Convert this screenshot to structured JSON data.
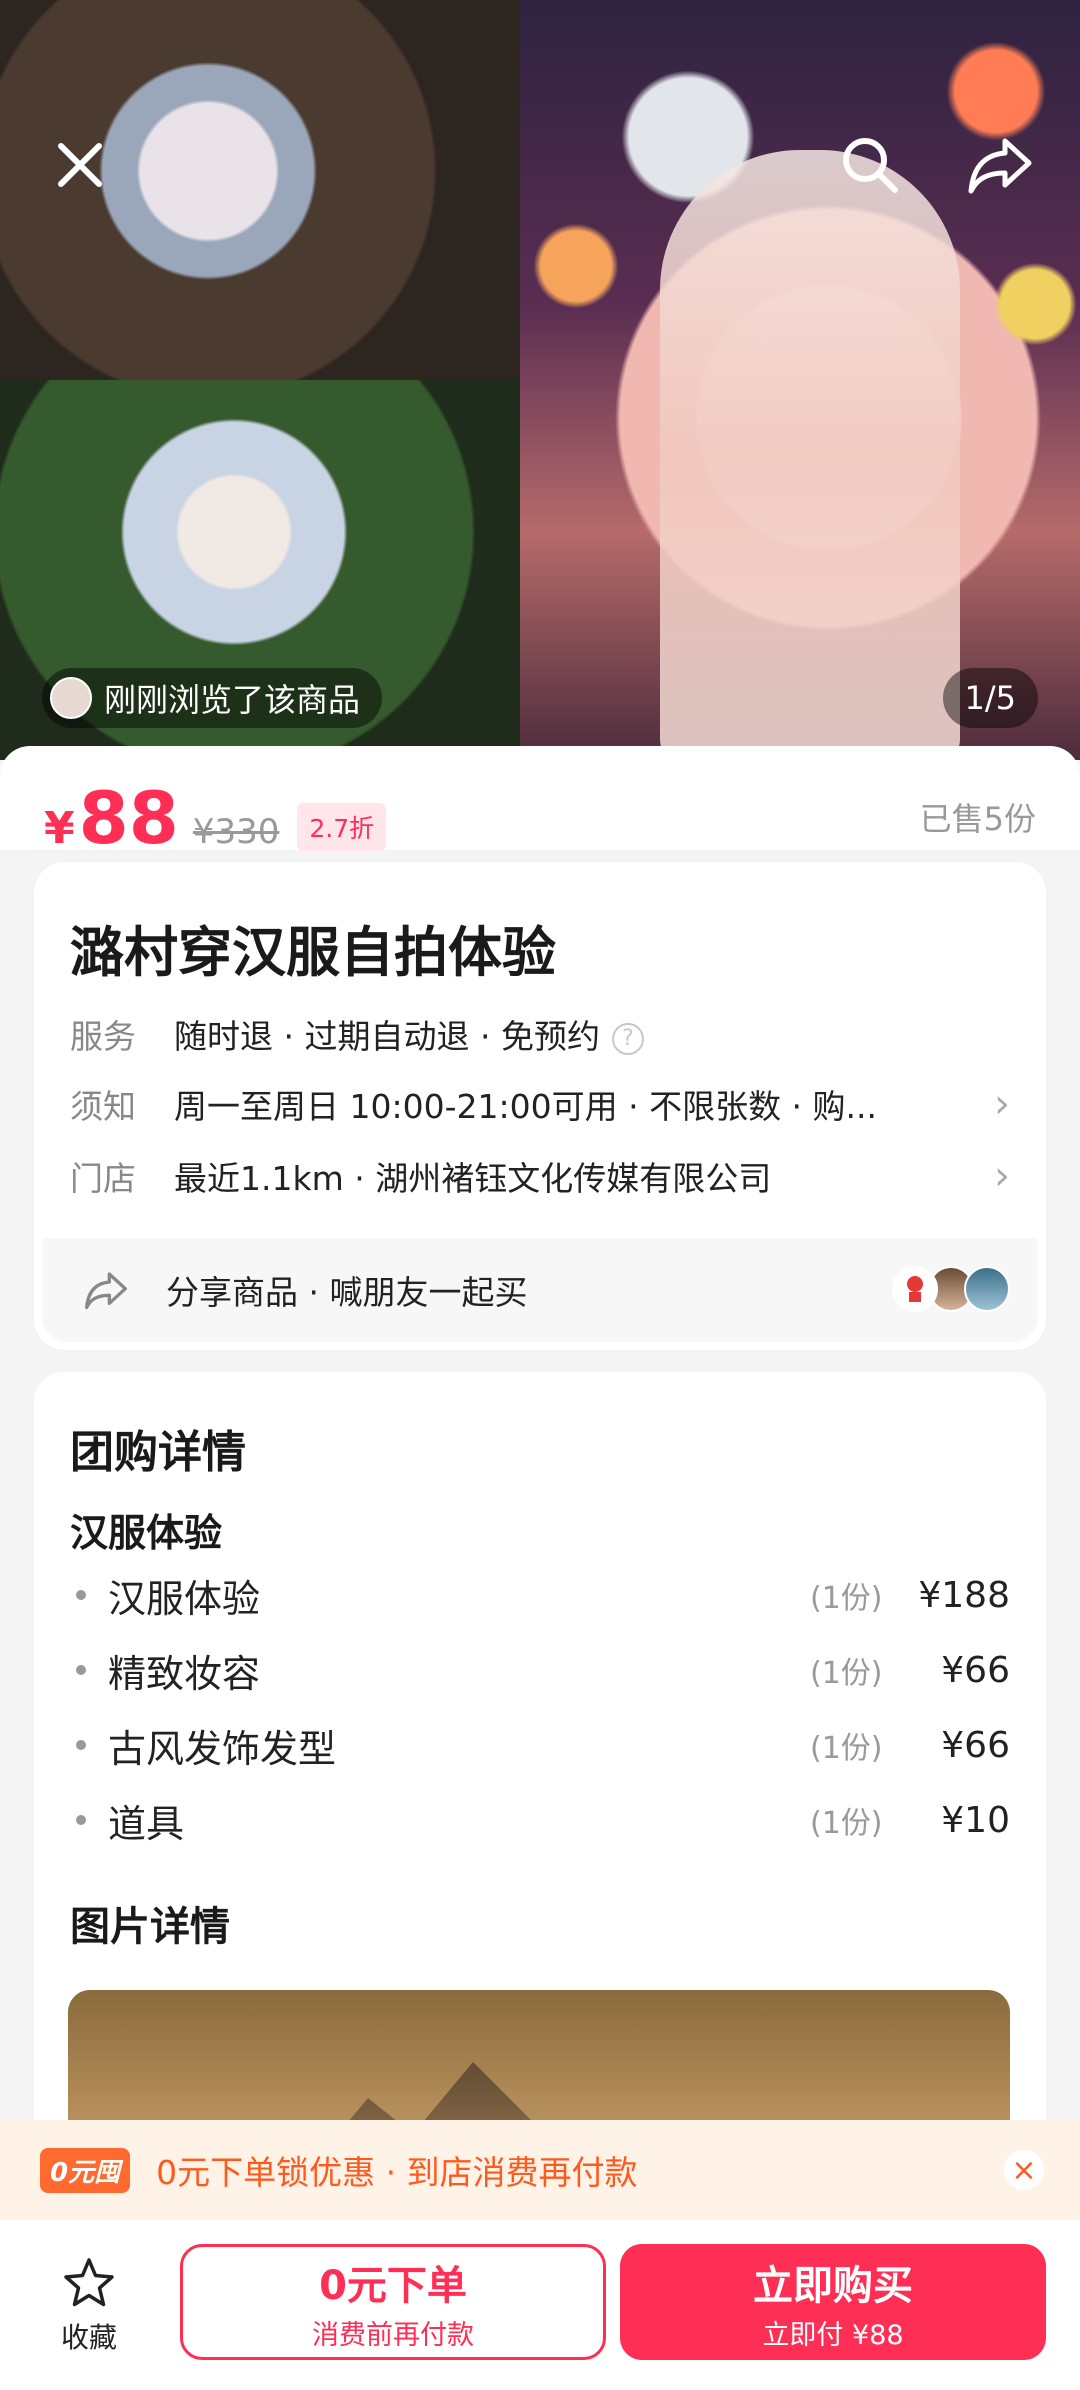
{
  "hero": {
    "viewed_text": "刚刚浏览了该商品",
    "page_indicator": "1/5",
    "icons": [
      "close-icon",
      "search-icon",
      "share-icon"
    ]
  },
  "price": {
    "currency": "¥",
    "current": "88",
    "original": "¥330",
    "discount": "2.7折",
    "sold": "已售5份"
  },
  "info": {
    "title": "潞村穿汉服自拍体验",
    "rows": [
      {
        "key": "服务",
        "value": "随时退 · 过期自动退 · 免预约"
      },
      {
        "key": "须知",
        "value": "周一至周日 10:00-21:00可用 · 不限张数 · 购..."
      },
      {
        "key": "门店",
        "value": "最近1.1km · 湖州褚钰文化传媒有限公司"
      }
    ],
    "share_label": "分享商品 · 喊朋友一起买"
  },
  "detail": {
    "heading": "团购详情",
    "group_title": "汉服体验",
    "items": [
      {
        "name": "汉服体验",
        "qty": "(1份)",
        "price": "¥188"
      },
      {
        "name": "精致妆容",
        "qty": "(1份)",
        "price": "¥66"
      },
      {
        "name": "古风发饰发型",
        "qty": "(1份)",
        "price": "¥66"
      },
      {
        "name": "道具",
        "qty": "(1份)",
        "price": "¥10"
      }
    ],
    "image_heading": "图片详情"
  },
  "promo": {
    "tag": "0元囤",
    "text": "0元下单锁优惠 · 到店消费再付款",
    "close": "×"
  },
  "bottom": {
    "fav_label": "收藏",
    "zero_title": "0元下单",
    "zero_sub": "消费前再付款",
    "buy_title": "立即购买",
    "buy_sub": "立即付 ¥88"
  },
  "colors": {
    "accent": "#ff2e55",
    "promo": "#ff5a1e"
  }
}
